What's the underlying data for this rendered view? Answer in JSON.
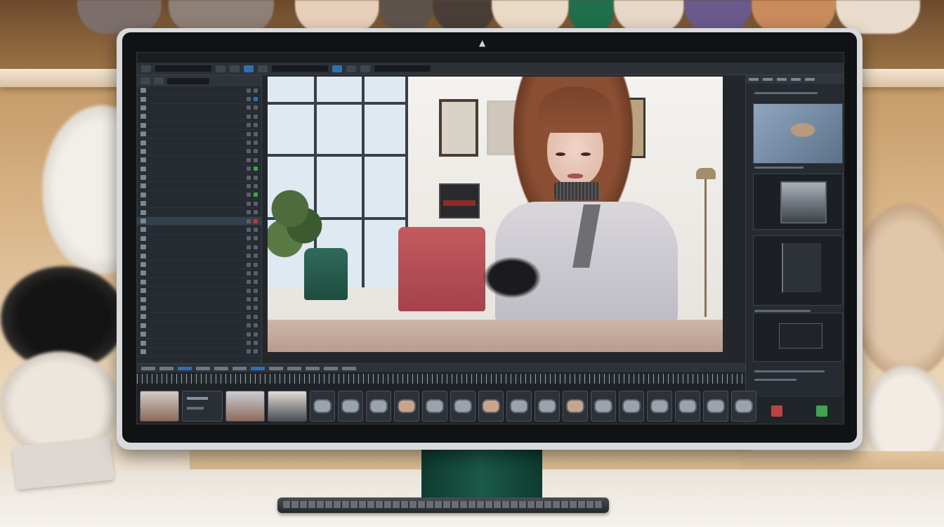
{
  "scene": {
    "description_colors": {
      "shelf_wood": "#9c7346",
      "desk": "#f1ece4",
      "monitor_bezel": "#101214",
      "monitor_frame": "#d9dadc",
      "stand": "#1b5a47",
      "app_bg": "#23272c",
      "accent_blue": "#2f6fb3"
    }
  },
  "app": {
    "menubar_items": [
      "",
      "",
      "",
      "",
      ""
    ],
    "left_panel": {
      "rows": [
        "",
        "",
        "",
        "",
        "",
        "",
        "",
        "",
        "",
        "",
        "",
        "",
        "",
        "",
        "",
        "",
        "",
        "",
        "",
        "",
        "",
        "",
        "",
        "",
        "",
        "",
        "",
        "",
        "",
        "",
        ""
      ]
    },
    "viewer": {
      "content": "photo-frame"
    },
    "timeline": {
      "clip_count": 22
    },
    "right_panel": {
      "thumbnail_count": 4
    }
  },
  "icons": {
    "camera": "camera-icon"
  }
}
